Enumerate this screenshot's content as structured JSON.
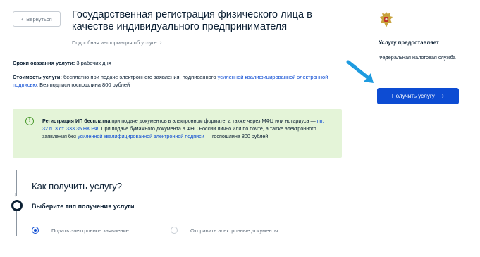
{
  "header": {
    "back_label": "Вернуться",
    "title": "Государственная регистрация физического лица в качестве индивидуального предпринимателя",
    "details_link": "Подробная информация об услуге"
  },
  "service_info": {
    "term_label": "Сроки оказания услуги:",
    "term_value": "3 рабочих дня",
    "cost_label": "Стоимость услуги:",
    "cost_text_1": "бесплатно при подаче электронного заявления, подписанного",
    "cost_link": "усиленной квалифицированной электронной подписью",
    "cost_text_2": ". Без подписи госпошлина 800 рублей"
  },
  "notice": {
    "bold": "Регистрация ИП бесплатна",
    "text_1": "при подаче документов в электронном формате, а также через МФЦ или нотариуса —",
    "link_1": "пп. 32 п. 3 ст. 333.35 НК РФ",
    "text_2": ". При подаче бумажного документа в ФНС России лично или по почте, а также электронного заявления без",
    "link_2": "усиленной квалифицированной электронной подписи",
    "text_3": "— госпошлина 800 рублей",
    "icon": "!"
  },
  "sidebar": {
    "emblem_icon": "coat-of-arms",
    "provider_label": "Услугу предоставляет",
    "provider_name": "Федеральная налоговая служба",
    "get_button": "Получить услугу"
  },
  "how": {
    "title": "Как получить услугу?",
    "step_title": "Выберите тип получения услуги",
    "options": [
      {
        "label": "Подать электронное заявление",
        "selected": true
      },
      {
        "label": "Отправить электронные документы",
        "selected": false
      }
    ]
  },
  "colors": {
    "accent": "#0d4cd3",
    "notice_bg": "#e4f4d8",
    "arrow": "#1e9be0"
  }
}
